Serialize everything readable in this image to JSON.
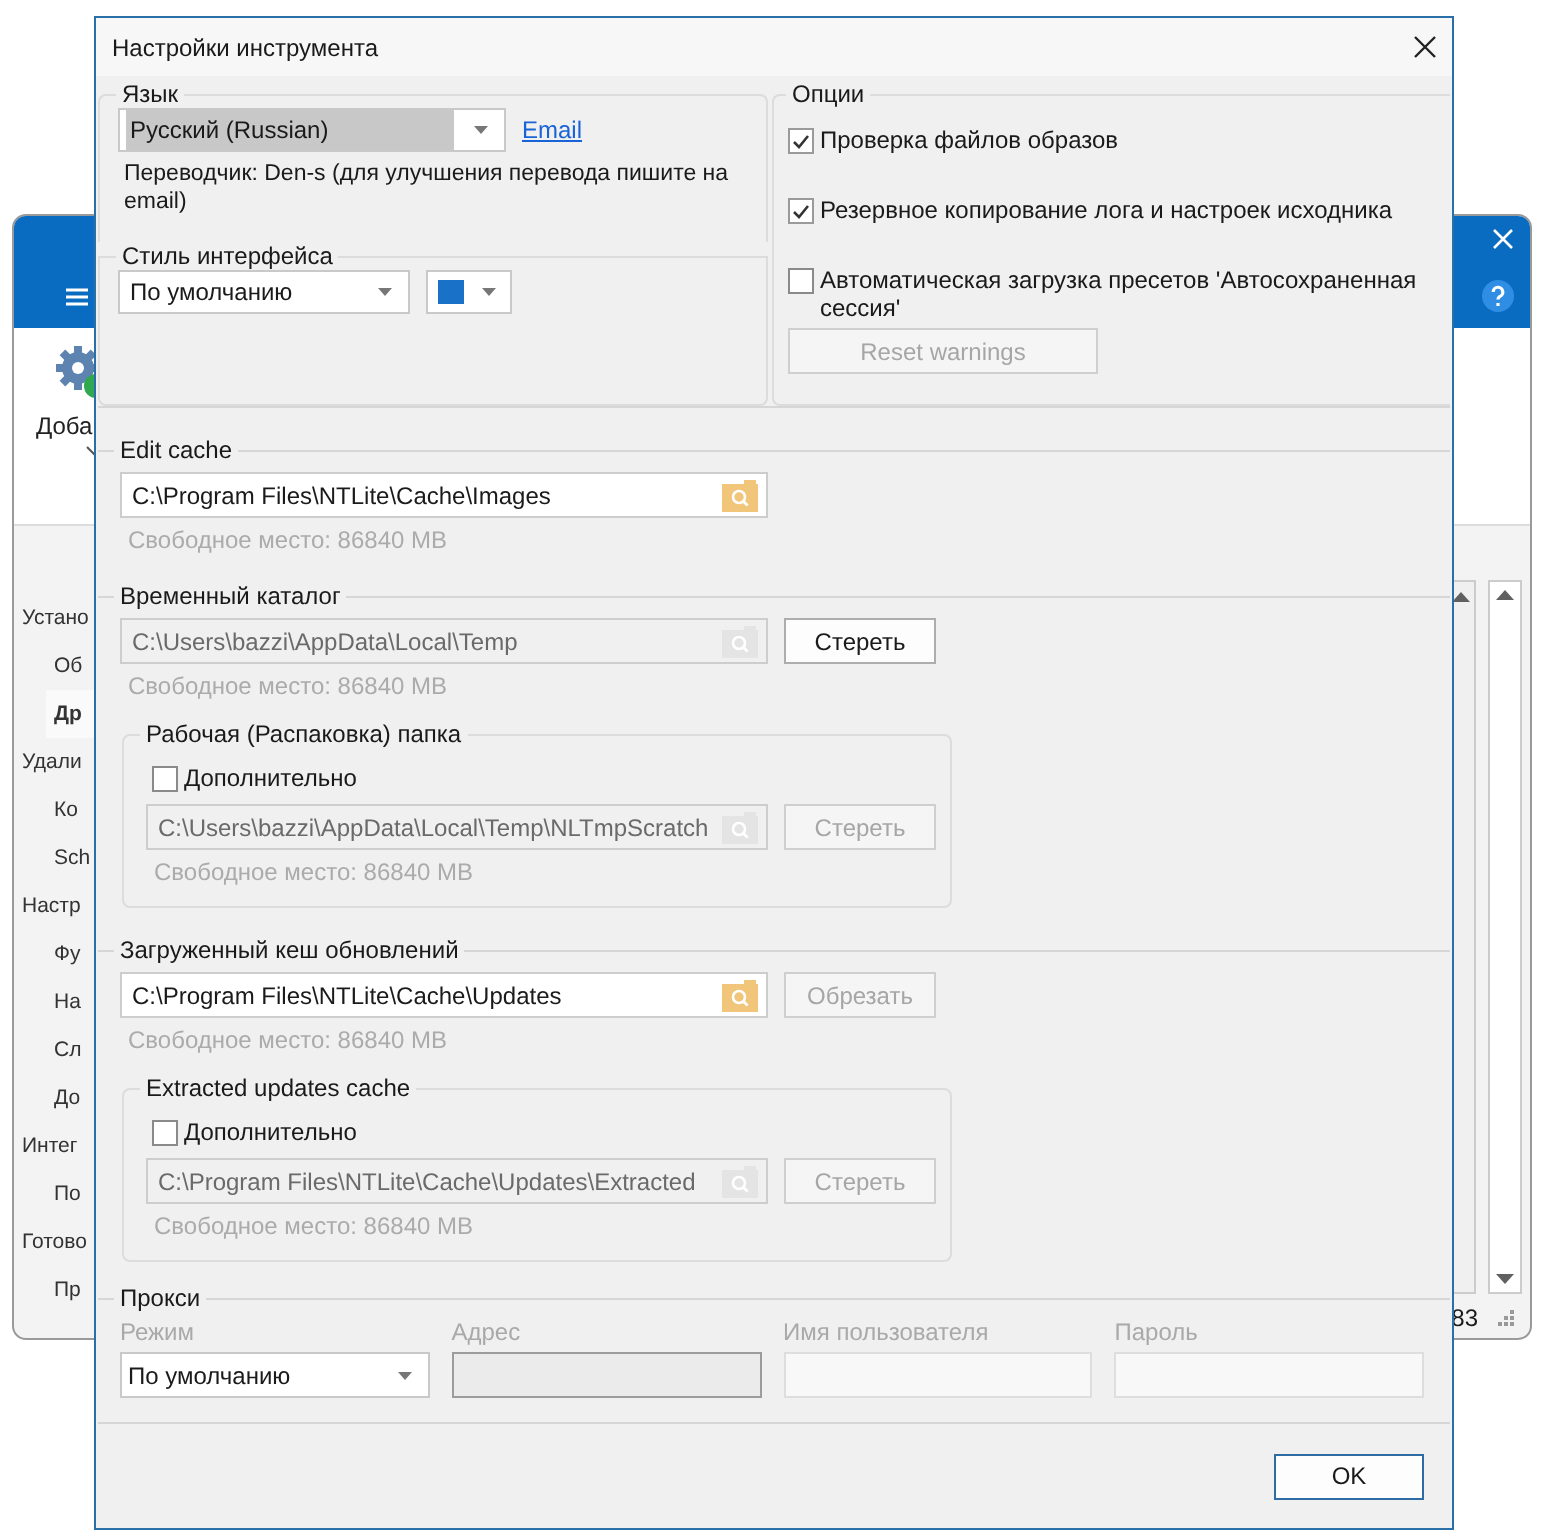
{
  "background_window": {
    "toolbar_button": {
      "label": "Доба"
    },
    "sidebar": {
      "items": [
        {
          "label": "Устано",
          "children": [
            {
              "label": "Об",
              "selected": false
            },
            {
              "label": "Др",
              "selected": true
            }
          ]
        },
        {
          "label": "Удали",
          "children": [
            {
              "label": "Ко",
              "selected": false
            },
            {
              "label": "Sch",
              "selected": false
            }
          ]
        },
        {
          "label": "Настр",
          "children": [
            {
              "label": "Фу",
              "selected": false
            },
            {
              "label": "На",
              "selected": false
            },
            {
              "label": "Сл",
              "selected": false
            },
            {
              "label": "До",
              "selected": false
            }
          ]
        },
        {
          "label": "Интег",
          "children": [
            {
              "label": "По",
              "selected": false
            }
          ]
        },
        {
          "label": "Готово",
          "children": [
            {
              "label": "Пр",
              "selected": false
            }
          ]
        }
      ]
    },
    "status": "83"
  },
  "dialog": {
    "title": "Настройки инструмента",
    "language": {
      "legend": "Язык",
      "select": {
        "value": "Русский (Russian)",
        "focused": true
      },
      "link": "Email",
      "note": "Переводчик: Den-s (для улучшения перевода пишите на email)"
    },
    "interface_style": {
      "legend": "Стиль интерфейса",
      "select": {
        "value": "По умолчанию",
        "focused": false
      },
      "color": "#1a72c8"
    },
    "options": {
      "legend": "Опции",
      "checkboxes": [
        {
          "label": "Проверка файлов образов",
          "checked": true
        },
        {
          "label": "Резервное копирование лога и настроек исходника",
          "checked": true
        },
        {
          "label": "Автоматическая загрузка пресетов 'Автосохраненная сессия'",
          "checked": false
        }
      ],
      "reset_button": {
        "label": "Reset warnings",
        "disabled": true
      }
    },
    "sections": [
      {
        "legend": "Edit cache",
        "path": {
          "value": "C:\\Program Files\\NTLite\\Cache\\Images",
          "disabled": false
        },
        "free_space": "Свободное место: 86840 MB"
      },
      {
        "legend": "Временный каталог",
        "path": {
          "value": "C:\\Users\\bazzi\\AppData\\Local\\Temp",
          "disabled": true
        },
        "button": {
          "label": "Стереть",
          "disabled": false
        },
        "free_space": "Свободное место: 86840 MB",
        "subgroup": {
          "legend": "Рабочая (Распаковка) папка",
          "checkbox": {
            "label": "Дополнительно",
            "checked": false
          },
          "path": {
            "value": "C:\\Users\\bazzi\\AppData\\Local\\Temp\\NLTmpScratch",
            "disabled": true
          },
          "button": {
            "label": "Стереть",
            "disabled": true
          },
          "free_space": "Свободное место: 86840 MB"
        }
      },
      {
        "legend": "Загруженный кеш обновлений",
        "path": {
          "value": "C:\\Program Files\\NTLite\\Cache\\Updates",
          "disabled": false
        },
        "button": {
          "label": "Обрезать",
          "disabled": true
        },
        "free_space": "Свободное место: 86840 MB",
        "subgroup": {
          "legend": "Extracted updates cache",
          "checkbox": {
            "label": "Дополнительно",
            "checked": false
          },
          "path": {
            "value": "C:\\Program Files\\NTLite\\Cache\\Updates\\Extracted",
            "disabled": true
          },
          "button": {
            "label": "Стереть",
            "disabled": true
          },
          "free_space": "Свободное место: 86840 MB"
        }
      }
    ],
    "proxy": {
      "legend": "Прокси",
      "disabled": true,
      "fields": [
        {
          "label": "Режим",
          "kind": "select",
          "value": "По умолчанию"
        },
        {
          "label": "Адрес",
          "kind": "readonly"
        },
        {
          "label": "Имя пользователя",
          "kind": "input"
        },
        {
          "label": "Пароль",
          "kind": "input"
        }
      ]
    },
    "ok_button": {
      "label": "OK"
    }
  }
}
